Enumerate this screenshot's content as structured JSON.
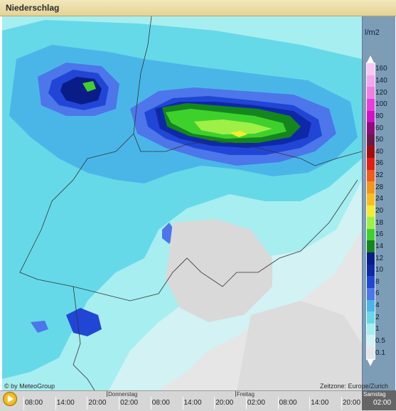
{
  "title": "Niederschlag",
  "legend": {
    "unit": "l/m2",
    "items": [
      {
        "label": "160",
        "color": "#f9c7f4"
      },
      {
        "label": "140",
        "color": "#f6a6ee"
      },
      {
        "label": "120",
        "color": "#f07fe5"
      },
      {
        "label": "100",
        "color": "#e83fdc"
      },
      {
        "label": "80",
        "color": "#d40fc8"
      },
      {
        "label": "60",
        "color": "#8f0a7a"
      },
      {
        "label": "50",
        "color": "#6b1a4c"
      },
      {
        "label": "40",
        "color": "#a40b10"
      },
      {
        "label": "36",
        "color": "#e41e12"
      },
      {
        "label": "32",
        "color": "#f35b19"
      },
      {
        "label": "28",
        "color": "#f6941c"
      },
      {
        "label": "24",
        "color": "#f8be1e"
      },
      {
        "label": "20",
        "color": "#f3ed2d"
      },
      {
        "label": "18",
        "color": "#9ef046"
      },
      {
        "label": "16",
        "color": "#3ed12c"
      },
      {
        "label": "14",
        "color": "#14861e"
      },
      {
        "label": "12",
        "color": "#091c88"
      },
      {
        "label": "10",
        "color": "#0e29a8"
      },
      {
        "label": "8",
        "color": "#2146d6"
      },
      {
        "label": "6",
        "color": "#4c76ea"
      },
      {
        "label": "4",
        "color": "#4ab6e8"
      },
      {
        "label": "2",
        "color": "#66d9e8"
      },
      {
        "label": "1",
        "color": "#a7eef0"
      },
      {
        "label": "0.5",
        "color": "#d2f2f3"
      },
      {
        "label": "0.1",
        "color": "#e6e6e6"
      }
    ]
  },
  "credit": "© by MeteoGroup",
  "timezone": "Zeitzone: Europe/Zurich",
  "timeline": {
    "days": [
      "Donnerstag",
      "Freitag",
      "Samstag"
    ],
    "times": [
      "08:00",
      "14:00",
      "20:00",
      "02:00",
      "08:00",
      "14:00",
      "20:00",
      "02:00",
      "08:00",
      "14:00",
      "20:00"
    ],
    "current": "02:00"
  }
}
